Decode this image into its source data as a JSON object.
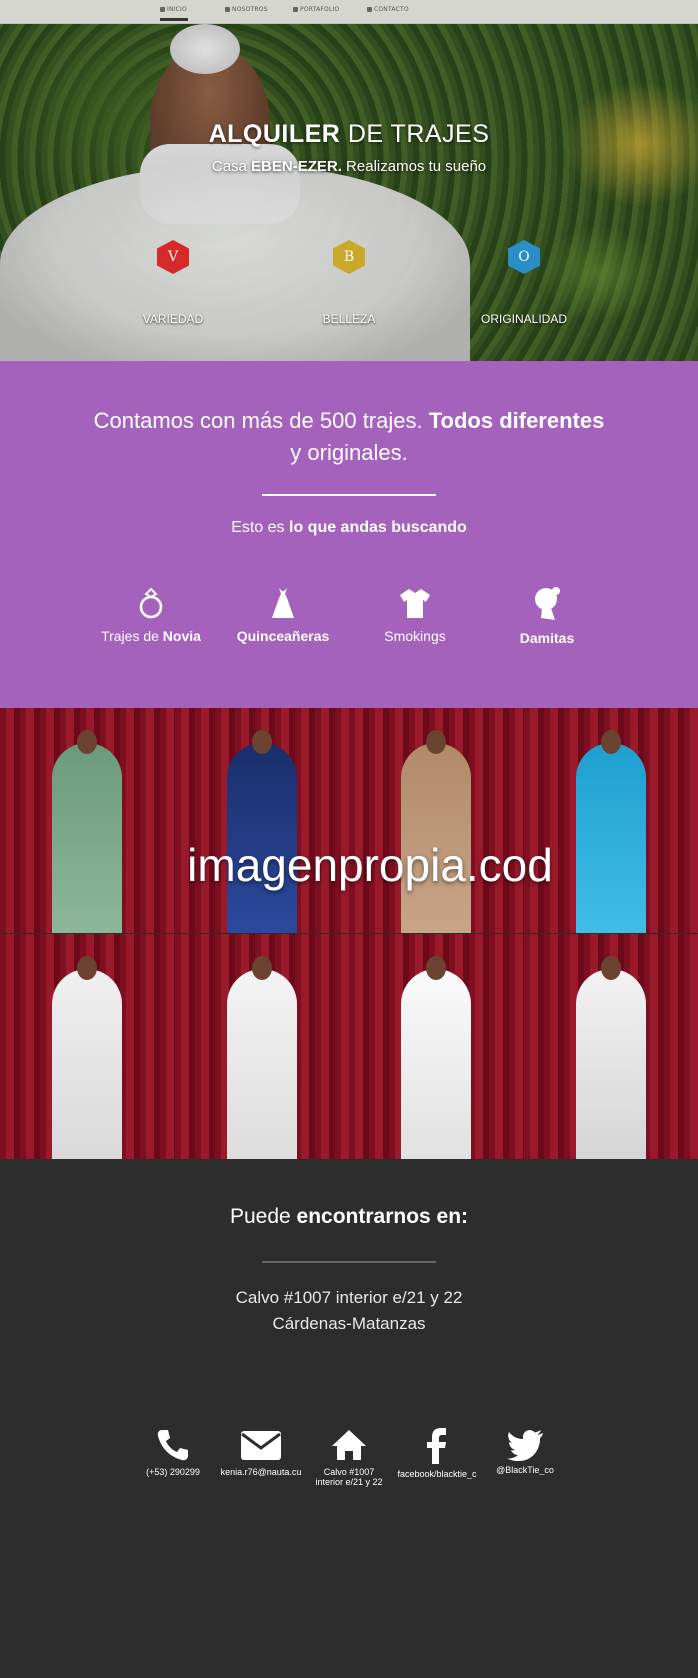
{
  "nav": {
    "items": [
      {
        "label": "INICIO",
        "icon": "home-icon"
      },
      {
        "label": "NOSOTROS",
        "icon": "user-icon"
      },
      {
        "label": "PORTAFOLIO",
        "icon": "briefcase-icon"
      },
      {
        "label": "CONTACTO",
        "icon": "envelope-icon"
      }
    ],
    "active": "INICIO"
  },
  "hero": {
    "title_bold": "ALQUILER",
    "title_rest": " DE TRAJES",
    "subtitle_pre": "Casa ",
    "subtitle_bold": "EBEN-EZER.",
    "subtitle_rest": " Realizamos tu sueño",
    "features": [
      {
        "letter": "V",
        "label": "VARIEDAD",
        "color": "#d62a2a"
      },
      {
        "letter": "B",
        "label": "BELLEZA",
        "color": "#c9a82a"
      },
      {
        "letter": "O",
        "label": "ORIGINALIDAD",
        "color": "#2a8fc9"
      }
    ]
  },
  "about": {
    "lead_pre": "Contamos con más de 500 trajes. ",
    "lead_bold": "Todos diferentes",
    "lead_post": " y originales.",
    "tagline_pre": "Esto es ",
    "tagline_bold": "lo que andas buscando",
    "bg_color": "#a562bd",
    "categories": [
      {
        "pre": "Trajes de ",
        "bold": "Novia",
        "icon": "ring-icon"
      },
      {
        "pre": "",
        "bold": "Quinceañeras",
        "icon": "dress-icon"
      },
      {
        "pre": "Smokings",
        "bold": "",
        "icon": "shirt-icon"
      },
      {
        "pre": "",
        "bold": "Damitas",
        "icon": "girl-icon"
      }
    ]
  },
  "gallery": {
    "watermark": "imagenpropia.cod"
  },
  "footer": {
    "title_pre": "Puede ",
    "title_bold": "encontrarnos en:",
    "address_line1": "Calvo #1007 interior e/21 y 22",
    "address_line2": "Cárdenas-Matanzas",
    "contacts": [
      {
        "icon": "phone-icon",
        "label": "(+53) 290299"
      },
      {
        "icon": "mail-icon",
        "label": "kenia.r76@nauta.cu"
      },
      {
        "icon": "home-icon",
        "label": "Calvo #1007",
        "label2": "interior e/21 y 22"
      },
      {
        "icon": "facebook-icon",
        "label": "facebook/blacktie_c"
      },
      {
        "icon": "twitter-icon",
        "label": "@BlackTie_co"
      }
    ]
  }
}
